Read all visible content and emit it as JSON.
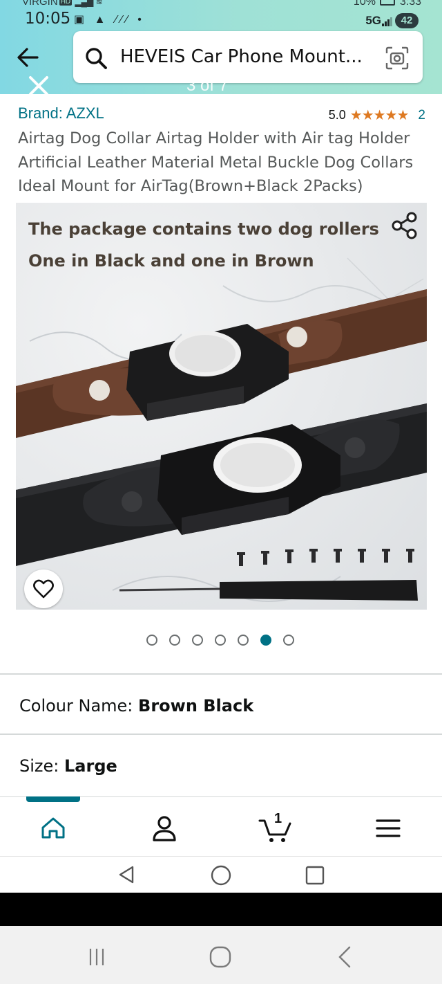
{
  "status_bar": {
    "carrier": "VIRGIN",
    "carrier_badge": "HD",
    "time": "10:05",
    "notification_icons": "▣ ▲ ⁄⁄⁄ •",
    "battery_percent": "10%",
    "battery_time": "3:33",
    "network": "5G",
    "notification_count": "42"
  },
  "search": {
    "query": "HEVEIS Car Phone Mount..."
  },
  "image_overlay": {
    "counter": "3 of 7"
  },
  "product": {
    "brand_label": "Brand: AZXL",
    "rating_value": "5.0",
    "rating_stars": "★★★★★",
    "rating_count": "2",
    "title": "Airtag Dog Collar Airtag Holder with Air tag Holder Artificial Leather Material Metal Buckle Dog Collars Ideal Mount for AirTag(Brown+Black 2Packs)",
    "image_caption_line1": "The package contains two dog rollers",
    "image_caption_line2": "One in Black and one in Brown"
  },
  "carousel": {
    "total": 7,
    "active_index": 5
  },
  "variations": {
    "colour_label": "Colour Name:",
    "colour_value": "Brown Black",
    "size_label": "Size:",
    "size_value": "Large"
  },
  "bottom_nav": {
    "cart_count": "1",
    "items": [
      "home-icon",
      "account-icon",
      "cart-icon",
      "menu-icon"
    ]
  },
  "colors": {
    "accent": "#007185",
    "header_gradient_start": "#82d8e3",
    "header_gradient_end": "#a5e4d2",
    "star": "#de7921"
  }
}
